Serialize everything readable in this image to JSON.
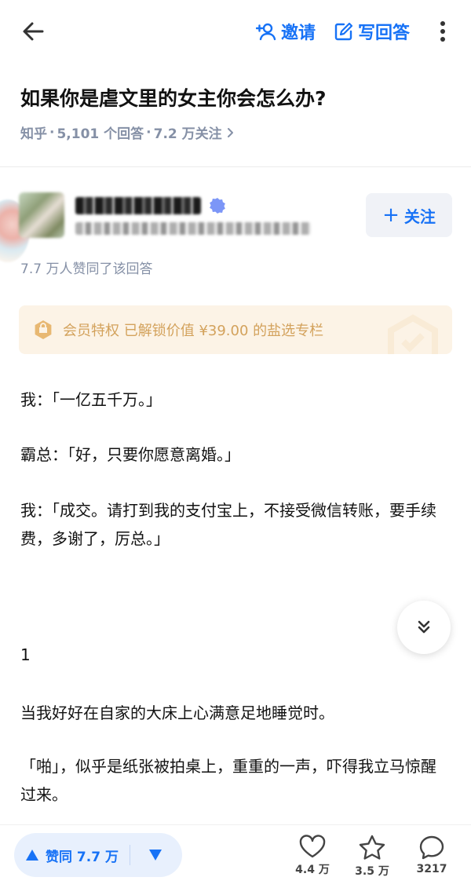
{
  "topbar": {
    "invite_label": "邀请",
    "write_answer_label": "写回答",
    "accent_color": "#1772f6"
  },
  "question": {
    "title": "如果你是虐文里的女主你会怎么办?",
    "source": "知乎",
    "answers": "5,101 个回答",
    "followers": "7.2 万关注"
  },
  "author": {
    "follow_label": "关注",
    "likes_summary": "7.7 万人赞同了该回答"
  },
  "member_banner": {
    "text": "会员特权 已解锁价值 ¥39.00 的盐选专栏",
    "color": "#d3a25c"
  },
  "content": {
    "paragraphs": [
      "我：「一亿五千万。」",
      "霸总：「好，只要你愿意离婚。」",
      "我：「成交。请打到我的支付宝上，不接受微信转账，要手续费，多谢了，厉总。」",
      "1",
      "当我好好在自家的大床上心满意足地睡觉时。",
      "「啪」，似乎是纸张被拍桌上，重重的一声，吓得我立马惊醒过来。"
    ]
  },
  "bottombar": {
    "upvote_label": "赞同 7.7 万",
    "like_count": "4.4 万",
    "favorite_count": "3.5 万",
    "comment_count": "3217",
    "icons": [
      "upvote-arrow-icon",
      "downvote-arrow-icon",
      "heart-icon",
      "star-icon",
      "comment-bubble-icon"
    ]
  }
}
